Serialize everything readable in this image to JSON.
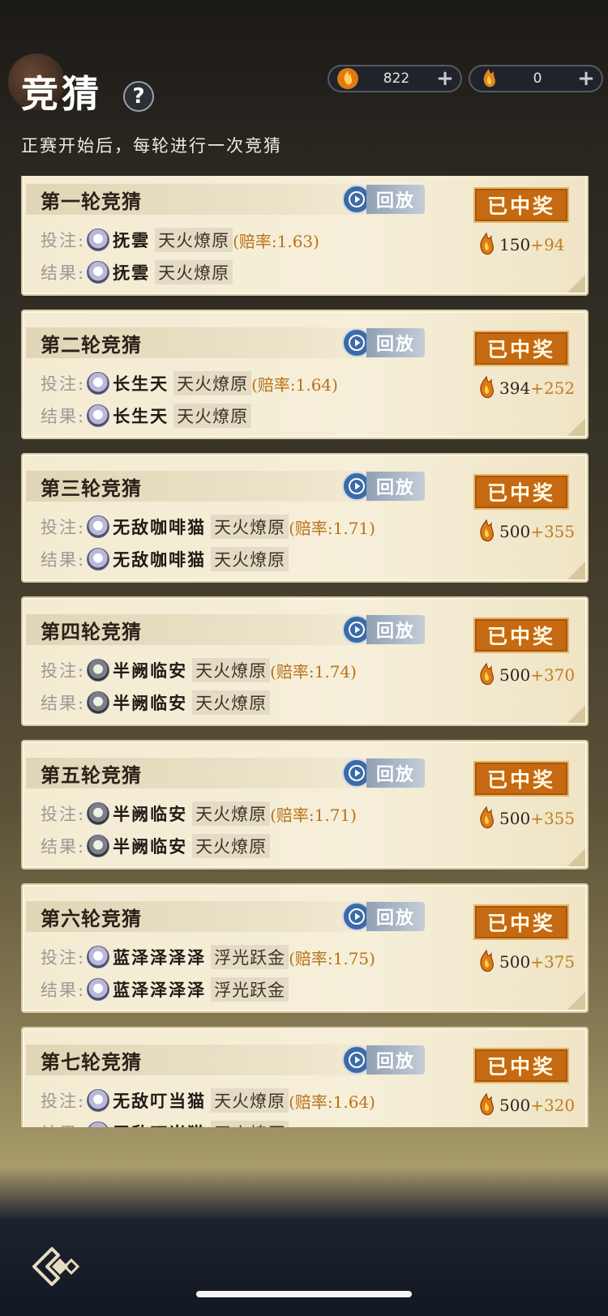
{
  "header": {
    "title": "竞猜",
    "help_label": "?",
    "subtitle": "正赛开始后，每轮进行一次竞猜"
  },
  "currencies": [
    {
      "icon": "flame-coin-icon",
      "value": "822",
      "plus": "+"
    },
    {
      "icon": "flame-coin-alt-icon",
      "value": "0",
      "plus": "+"
    }
  ],
  "labels": {
    "bet": "投注:",
    "result": "结果:",
    "replay": "回放",
    "won": "已中奖"
  },
  "rounds": [
    {
      "title": "第一轮竞猜",
      "bet_player": "抚雲",
      "bet_team": "天火燎原",
      "odds": "(赔率:1.63)",
      "result_player": "抚雲",
      "result_team": "天火燎原",
      "status": "已中奖",
      "base": "150",
      "bonus": "+94"
    },
    {
      "title": "第二轮竞猜",
      "bet_player": "长生天",
      "bet_team": "天火燎原",
      "odds": "(赔率:1.64)",
      "result_player": "长生天",
      "result_team": "天火燎原",
      "status": "已中奖",
      "base": "394",
      "bonus": "+252"
    },
    {
      "title": "第三轮竞猜",
      "bet_player": "无敌咖啡猫",
      "bet_team": "天火燎原",
      "odds": "(赔率:1.71)",
      "result_player": "无敌咖啡猫",
      "result_team": "天火燎原",
      "status": "已中奖",
      "base": "500",
      "bonus": "+355"
    },
    {
      "title": "第四轮竞猜",
      "bet_player": "半阙临安",
      "bet_team": "天火燎原",
      "odds": "(赔率:1.74)",
      "result_player": "半阙临安",
      "result_team": "天火燎原",
      "status": "已中奖",
      "base": "500",
      "bonus": "+370"
    },
    {
      "title": "第五轮竞猜",
      "bet_player": "半阙临安",
      "bet_team": "天火燎原",
      "odds": "(赔率:1.71)",
      "result_player": "半阙临安",
      "result_team": "天火燎原",
      "status": "已中奖",
      "base": "500",
      "bonus": "+355"
    },
    {
      "title": "第六轮竞猜",
      "bet_player": "蓝泽泽泽泽",
      "bet_team": "浮光跃金",
      "odds": "(赔率:1.75)",
      "result_player": "蓝泽泽泽泽",
      "result_team": "浮光跃金",
      "status": "已中奖",
      "base": "500",
      "bonus": "+375"
    },
    {
      "title": "第七轮竞猜",
      "bet_player": "无敌叮当猫",
      "bet_team": "天火燎原",
      "odds": "(赔率:1.64)",
      "result_player": "无敌叮当猫",
      "result_team": "天火燎原",
      "status": "已中奖",
      "base": "500",
      "bonus": "+320"
    }
  ],
  "colors": {
    "accent_orange": "#c56a12",
    "bonus_text": "#c47b1f",
    "replay_blue": "#3c6aa8"
  }
}
